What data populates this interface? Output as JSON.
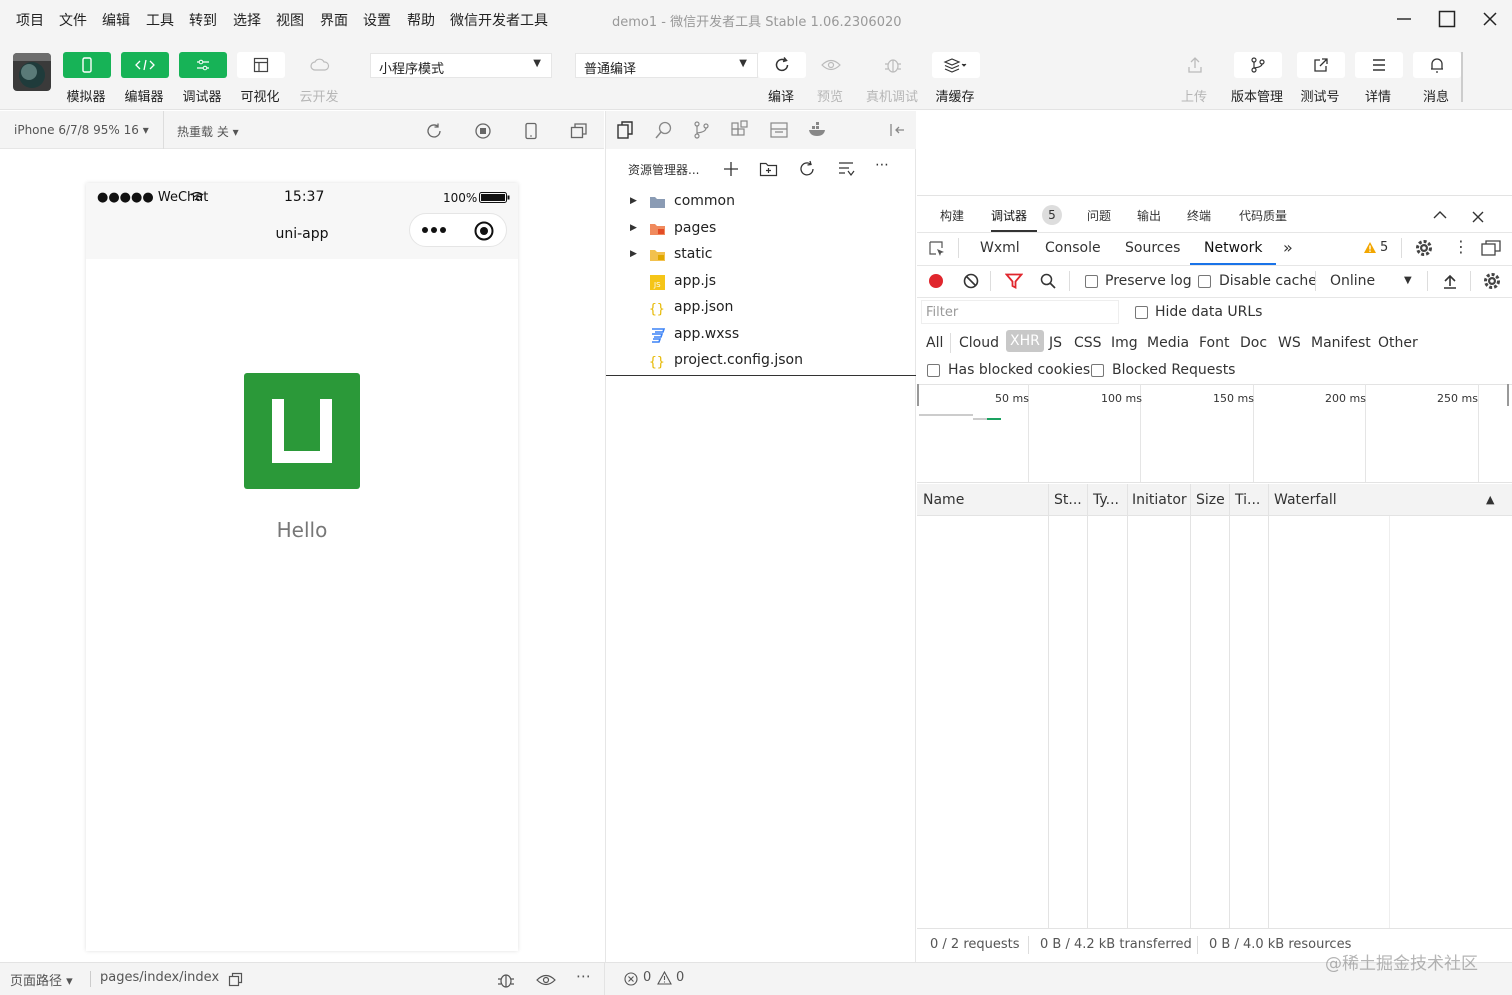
{
  "menu": [
    "项目",
    "文件",
    "编辑",
    "工具",
    "转到",
    "选择",
    "视图",
    "界面",
    "设置",
    "帮助",
    "微信开发者工具"
  ],
  "window": {
    "title": "demo1 - 微信开发者工具 Stable 1.06.2306020"
  },
  "toolbar": {
    "left": [
      "模拟器",
      "编辑器",
      "调试器",
      "可视化",
      "云开发"
    ],
    "mode_select": "小程序模式",
    "compile_select": "普通编译",
    "mid": [
      "编译",
      "预览",
      "真机调试",
      "清缓存"
    ],
    "right": [
      "上传",
      "版本管理",
      "测试号",
      "详情",
      "消息"
    ]
  },
  "simulator": {
    "device": "iPhone 6/7/8 95% 16 ▾",
    "hot_reload": "热重载 关 ▾",
    "carrier": "●●●●● WeChat",
    "time": "15:37",
    "battery": "100%",
    "nav_title": "uni-app",
    "hello": "Hello"
  },
  "explorer": {
    "title": "资源管理器...",
    "files": [
      {
        "name": "common",
        "type": "folder",
        "expanded": false
      },
      {
        "name": "pages",
        "type": "folder",
        "expanded": false
      },
      {
        "name": "static",
        "type": "folder",
        "expanded": false
      },
      {
        "name": "app.js",
        "type": "js"
      },
      {
        "name": "app.json",
        "type": "json"
      },
      {
        "name": "app.wxss",
        "type": "wxss"
      },
      {
        "name": "project.config.json",
        "type": "json"
      }
    ]
  },
  "devtools": {
    "top_tabs": [
      "构建",
      "调试器",
      "问题",
      "输出",
      "终端",
      "代码质量"
    ],
    "debugger_badge": "5",
    "panel_tabs": [
      "Wxml",
      "Console",
      "Sources",
      "Network"
    ],
    "active_panel": "Network",
    "warnings": "5",
    "preserve_log": "Preserve log",
    "disable_cache": "Disable cache",
    "throttle": "Online",
    "filter_placeholder": "Filter",
    "hide_data_urls": "Hide data URLs",
    "type_filters": [
      "All",
      "Cloud",
      "XHR",
      "JS",
      "CSS",
      "Img",
      "Media",
      "Font",
      "Doc",
      "WS",
      "Manifest",
      "Other"
    ],
    "active_filter": "XHR",
    "has_blocked_cookies": "Has blocked cookies",
    "blocked_requests": "Blocked Requests",
    "timeline_labels": [
      "50 ms",
      "100 ms",
      "150 ms",
      "200 ms",
      "250 ms"
    ],
    "columns": [
      "Name",
      "St...",
      "Ty...",
      "Initiator",
      "Size",
      "Ti...",
      "Waterfall"
    ],
    "summary": [
      "0 / 2 requests",
      "0 B / 4.2 kB transferred",
      "0 B / 4.0 kB resources"
    ]
  },
  "statusbar": {
    "path_label": "页面路径 ▾",
    "path": "pages/index/index",
    "errors": "0",
    "warnings": "0"
  },
  "watermark": "@稀土掘金技术社区",
  "colors": {
    "accent_green": "#17b357",
    "uni_green": "#2b9939",
    "network_blue": "#1a73e8"
  }
}
